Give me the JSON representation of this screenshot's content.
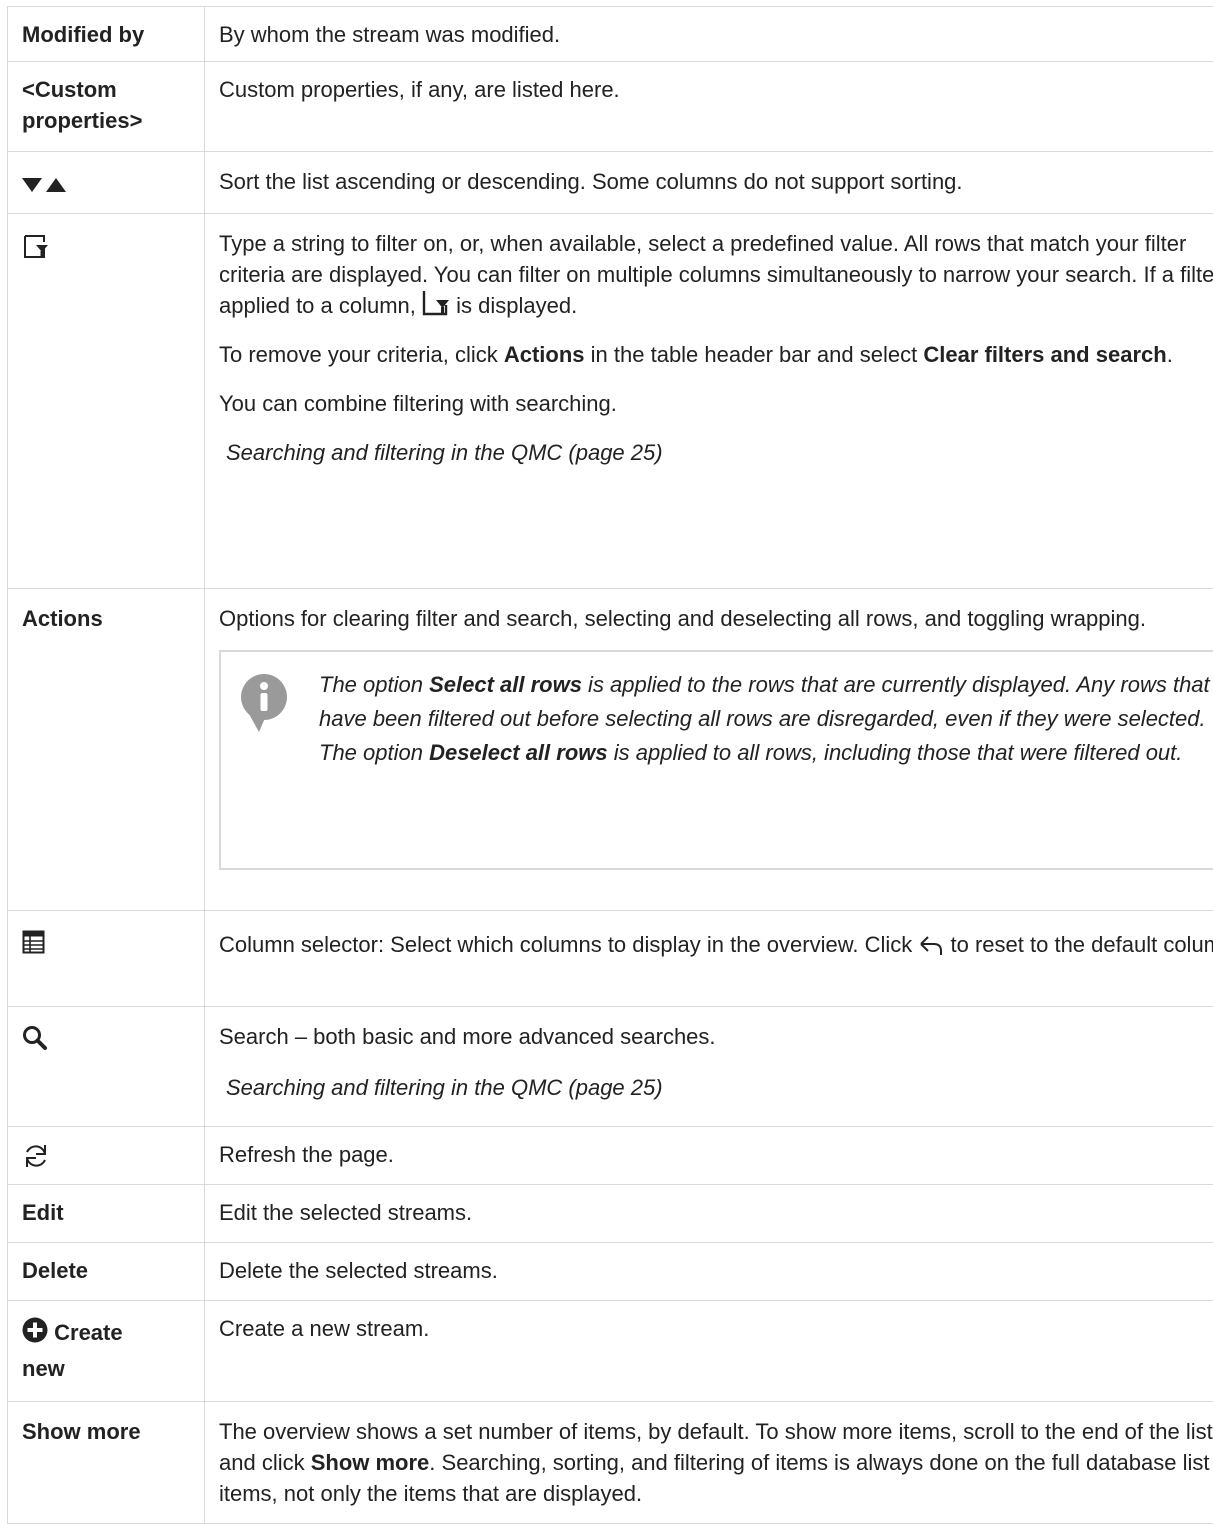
{
  "rows": {
    "modified_by": {
      "term": "Modified by",
      "desc": "By whom the stream was modified."
    },
    "custom": {
      "term_line1": "<Custom",
      "term_line2": "properties>",
      "desc": "Custom properties, if any, are listed here."
    },
    "sort": {
      "icon": "sort-arrows-icon",
      "desc": "Sort the list ascending or descending. Some columns do not support sorting."
    },
    "filter": {
      "icon": "filter-icon",
      "p1_a": "Type a string to filter on, or, when available, select a predefined value. All rows that match your filter criteria are displayed. You can filter on multiple columns simultaneously to narrow your search. If a filter is applied to a column, ",
      "p1_b": " is displayed.",
      "p2_a": "To remove your criteria, click ",
      "p2_actions": "Actions",
      "p2_b": " in the table header bar and select ",
      "p2_clear": "Clear filters and search",
      "p2_c": ".",
      "p3": "You can combine filtering with searching.",
      "link": "Searching and filtering in the QMC (page 25)"
    },
    "actions": {
      "term": "Actions",
      "desc": "Options for clearing filter and search, selecting and deselecting all rows, and toggling wrapping.",
      "note": {
        "icon": "info-icon",
        "t1": "The option ",
        "b1": "Select all rows",
        "t2": " is applied to the rows that are currently displayed. Any rows that have been filtered out before selecting all rows are disregarded, even if they were selected. The option ",
        "b2": "Deselect all rows",
        "t3": " is applied to all rows, including those that were filtered out."
      }
    },
    "columns": {
      "icon": "column-selector-icon",
      "desc_a": "Column selector: Select which columns to display in the overview. Click ",
      "desc_b": " to reset to the default columns.",
      "reset_icon": "reset-arrow-icon"
    },
    "search": {
      "icon": "search-icon",
      "desc": "Search – both basic and more advanced searches.",
      "link": "Searching and filtering in the QMC (page 25)"
    },
    "refresh": {
      "icon": "refresh-icon",
      "desc": "Refresh the page."
    },
    "edit": {
      "term": "Edit",
      "desc": "Edit the selected streams."
    },
    "delete": {
      "term": "Delete",
      "desc": "Delete the selected streams."
    },
    "create": {
      "icon": "plus-circle-icon",
      "term_line1": "Create",
      "term_line2": "new",
      "desc": "Create a new stream."
    },
    "show_more": {
      "term": "Show more",
      "desc_a": "The overview shows a set number of items, by default. To show more items, scroll to the end of the list and click ",
      "desc_b": "Show more",
      "desc_c": ". Searching, sorting, and filtering of items is always done on the full database list of items, not only the items that are displayed."
    }
  },
  "colors": {
    "border": "#d9d9d9",
    "text": "#222222",
    "icon": "#333333",
    "info_icon": "#9a9a9a"
  }
}
